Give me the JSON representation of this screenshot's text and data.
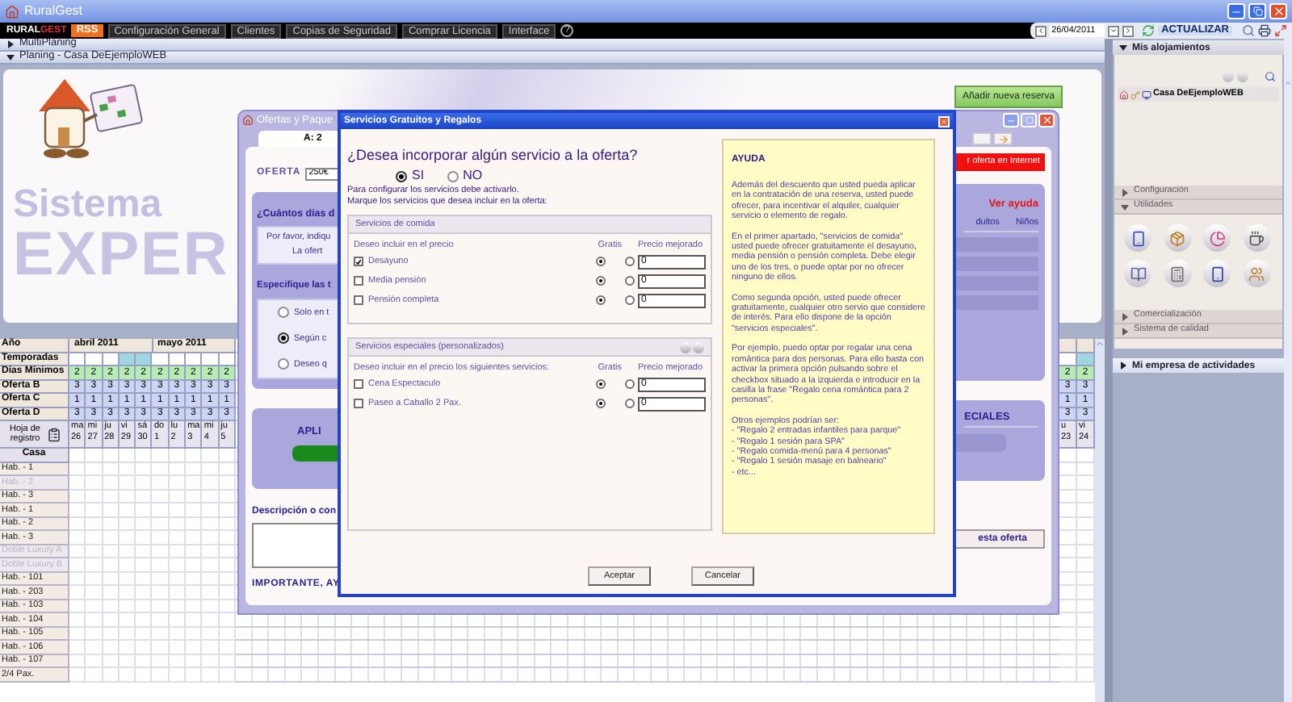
{
  "window": {
    "title": "RuralGest"
  },
  "menu": {
    "logo_a": "RURAL",
    "logo_b": "GEST",
    "rss": "RSS",
    "items": [
      "Configuración General",
      "Clientes",
      "Copias de Seguridad",
      "Comprar Licencia",
      "Interface"
    ],
    "help": "?"
  },
  "date_bar": {
    "date": "26/04/2011",
    "refresh": "ACTUALIZAR"
  },
  "sections": [
    {
      "label": "MultiPlaning",
      "expanded": false
    },
    {
      "label": "Planing - Casa DeEjemploWEB",
      "expanded": true
    }
  ],
  "banner": {
    "title_a": "Sistema",
    "title_b": "EXPER",
    "add_button": "Añadir nueva reserva"
  },
  "planning": {
    "year_label": "Año",
    "season_label": "Temporadas",
    "register_label": "Hoja de registro",
    "house_label": "Casa",
    "value_rows": [
      {
        "label": "Días Mínimos",
        "kind": "minimum"
      },
      {
        "label": "Oferta B",
        "kind": "offer"
      },
      {
        "label": "Oferta C",
        "kind": "offer"
      },
      {
        "label": "Oferta D",
        "kind": "offer"
      }
    ],
    "months": [
      {
        "label": "abril 2011",
        "days": [
          {
            "weekday": "ma",
            "date": "26",
            "season": false,
            "values": [
              "2",
              "3",
              "1",
              "3"
            ]
          },
          {
            "weekday": "mi",
            "date": "27",
            "season": false,
            "values": [
              "2",
              "3",
              "1",
              "3"
            ]
          },
          {
            "weekday": "ju",
            "date": "28",
            "season": false,
            "values": [
              "2",
              "3",
              "1",
              "3"
            ]
          },
          {
            "weekday": "vi",
            "date": "29",
            "season": true,
            "values": [
              "2",
              "3",
              "1",
              "3"
            ]
          },
          {
            "weekday": "sá",
            "date": "30",
            "season": true,
            "values": [
              "2",
              "3",
              "1",
              "3"
            ]
          }
        ]
      },
      {
        "label": "mayo 2011",
        "days": [
          {
            "weekday": "do",
            "date": "1",
            "season": false,
            "values": [
              "2",
              "3",
              "1",
              "3"
            ]
          },
          {
            "weekday": "lu",
            "date": "2",
            "season": false,
            "values": [
              "2",
              "3",
              "1",
              "3"
            ]
          },
          {
            "weekday": "ma",
            "date": "3",
            "season": false,
            "values": [
              "2",
              "3",
              "1",
              "3"
            ]
          },
          {
            "weekday": "mi",
            "date": "4",
            "season": false,
            "values": [
              "2",
              "3",
              "1",
              "3"
            ]
          },
          {
            "weekday": "ju",
            "date": "5",
            "season": false,
            "values": [
              "2",
              "3",
              "1",
              "3"
            ]
          }
        ]
      }
    ],
    "later_days": [
      {
        "weekday": "u",
        "date": "23",
        "season": false,
        "values": [
          "2",
          "3",
          "1",
          "3"
        ]
      },
      {
        "weekday": "vi",
        "date": "24",
        "season": true,
        "values": [
          "2",
          "3",
          "1",
          "3"
        ]
      }
    ],
    "rooms": [
      {
        "label": "Hab. - 1",
        "disabled": false
      },
      {
        "label": "Hab. - 2",
        "disabled": true
      },
      {
        "label": "Hab. - 3",
        "disabled": false
      },
      {
        "label": "Hab. - 1",
        "disabled": false
      },
      {
        "label": "Hab. - 2",
        "disabled": false
      },
      {
        "label": "Hab. - 3",
        "disabled": false
      },
      {
        "label": "Doble Luxury A",
        "disabled": true
      },
      {
        "label": "Doble Luxury B",
        "disabled": true
      },
      {
        "label": "Hab. - 101",
        "disabled": false
      },
      {
        "label": "Hab. - 203",
        "disabled": false
      },
      {
        "label": "Hab. - 103",
        "disabled": false
      },
      {
        "label": "Hab. - 104",
        "disabled": false
      },
      {
        "label": "Hab. - 105",
        "disabled": false
      },
      {
        "label": "Hab. - 106",
        "disabled": false
      },
      {
        "label": "Hab. - 107",
        "disabled": false
      },
      {
        "label": "2/4 Pax.",
        "disabled": false
      }
    ]
  },
  "offers_window": {
    "title": "Ofertas y Paque",
    "tab": "A: 2",
    "offer_label": "OFERTA",
    "offer_value": "250€",
    "days_heading": "¿Cuántos días d",
    "days_hint": "Por favor, indiqu",
    "days_note": "La ofert",
    "type_heading": "Especifique las t",
    "type_options": [
      {
        "label": "Solo en t",
        "selected": false
      },
      {
        "label": "Según c",
        "selected": true
      },
      {
        "label": "Deseo q",
        "selected": false
      }
    ],
    "apply_heading": "APLI",
    "description_label": "Descripción o con",
    "important": "IMPORTANTE, AY",
    "internet_button": "r oferta en Internet",
    "help_link": "Ver ayuda",
    "columns": [
      "dultos",
      "Niños"
    ],
    "specials_heading": "ECIALES",
    "save_button": "esta oferta"
  },
  "dialog": {
    "title": "Servicios Gratuitos y Regalos",
    "question": "¿Desea incorporar algún servicio a la oferta?",
    "answers": [
      {
        "label": "SI",
        "selected": true
      },
      {
        "label": "NO",
        "selected": false
      }
    ],
    "instructions": [
      "Para configurar los servicios debe activarlo.",
      "Marque los servicios que desea incluir en la oferta:"
    ],
    "groups": [
      {
        "title": "Servicios de comida",
        "intro": "Deseo incluir en el precio",
        "free_label": "Gratis",
        "price_label": "Precio mejorado",
        "has_tools": false,
        "items": [
          {
            "label": "Desayuno",
            "checked": true,
            "free": true,
            "price": "0"
          },
          {
            "label": "Media pensión",
            "checked": false,
            "free": true,
            "price": "0"
          },
          {
            "label": "Pensión completa",
            "checked": false,
            "free": true,
            "price": "0"
          }
        ]
      },
      {
        "title": "Servicios especiales (personalizados)",
        "intro": "Deseo incluir en el precio los siguientes servicios:",
        "free_label": "Gratis",
        "price_label": "Precio mejorado",
        "has_tools": true,
        "items": [
          {
            "label": "Cena Espectaculo",
            "checked": false,
            "free": true,
            "price": "0"
          },
          {
            "label": "Paseo a Caballo 2 Pax.",
            "checked": false,
            "free": true,
            "price": "0"
          }
        ]
      }
    ],
    "help": {
      "title": "AYUDA",
      "paragraphs": [
        "Además del descuento que usted pueda aplicar en la contratación de una reserva, usted puede ofrecer, para incentivar el alquiler, cualquier servicio o elemento de regalo.",
        "En el primer apartado, \"servicios de comida\" usted puede ofrecer gratuitamente el desayuno, media pensión o pensión completa. Debe elegir uno de los tres, o puede optar por no ofrecer ninguno de ellos.",
        "Como segunda opción, usted puede ofrecer gratuitamente, cualquier otro servio que considere de interés. Para ello dispone de la opción \"servicios especiales\".",
        "Por ejemplo, puedo optar por regalar una cena romántica para dos personas. Para ello basta con activar la primera opción pulsando sobre el checkbox situado a la izquierda e introducir en la casilla la frase \"Regalo cena romántica para 2 personas\"."
      ],
      "examples_intro": "Otros ejemplos podrían ser:",
      "examples": [
        "- \"Regalo 2 entradas infantiles para parque\"",
        "- \"Regalo 1 sesión para SPA\"",
        "- \"Regalo comida-menú para 4 personas\"",
        "- \"Regalo 1 sesión masaje en balneario\"",
        "- etc..."
      ]
    },
    "buttons": [
      "Aceptar",
      "Cancelar"
    ]
  },
  "side_panel": {
    "accommodations": {
      "label": "Mis alojamientos",
      "expanded": true,
      "items": [
        "Casa DeEjemploWEB"
      ]
    },
    "sections": [
      {
        "label": "Configuración",
        "expanded": false
      },
      {
        "label": "Utilidades",
        "expanded": true
      },
      {
        "label": "Comercialización",
        "expanded": false
      },
      {
        "label": "Sistema de calidad",
        "expanded": false
      }
    ],
    "company": {
      "label": "Mi empresa de actividades",
      "expanded": false
    }
  }
}
